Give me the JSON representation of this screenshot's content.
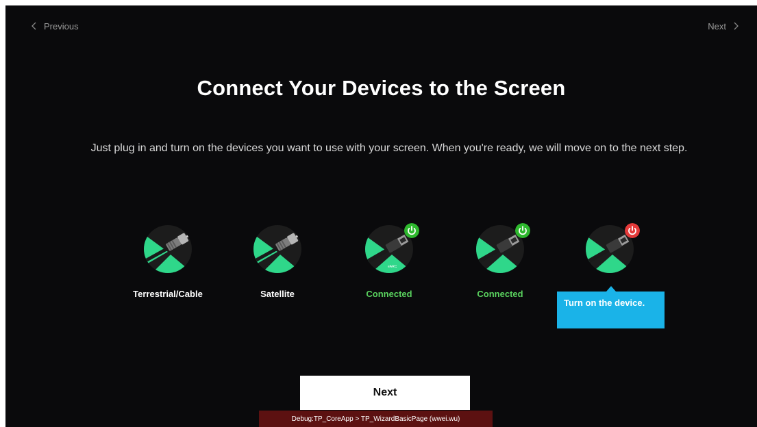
{
  "nav": {
    "previous_label": "Previous",
    "next_label": "Next"
  },
  "title": "Connect Your Devices to the Screen",
  "description": "Just plug in and turn on the devices you want to use with your screen. When you're ready, we will move on to the next step.",
  "devices": [
    {
      "label": "Terrestrial/Cable",
      "status": "none",
      "icon": "coax-cable-icon"
    },
    {
      "label": "Satellite",
      "status": "none",
      "icon": "coax-cable-icon"
    },
    {
      "label": "Connected",
      "status": "on",
      "icon": "hdmi-earc-icon",
      "port_text": "eARC"
    },
    {
      "label": "Connected",
      "status": "on",
      "icon": "hdmi-icon"
    },
    {
      "label": "",
      "status": "off",
      "icon": "hdmi-icon"
    }
  ],
  "tooltip": {
    "text": "Turn on the device."
  },
  "next_button_label": "Next",
  "debug_text": "Debug:TP_CoreApp > TP_WizardBasicPage (wwei.wu)",
  "colors": {
    "background": "#0a0a0c",
    "accent_green": "#2fd78a",
    "connected_text": "#5ad35f",
    "power_on": "#2eb82e",
    "power_off": "#e43a3a",
    "tooltip": "#1ab3e8",
    "debug_bar": "#5c1111"
  }
}
